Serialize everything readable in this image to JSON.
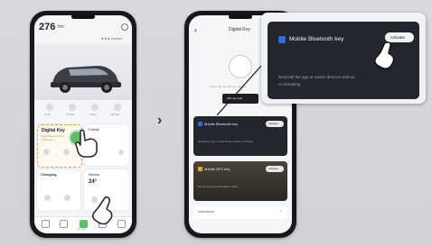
{
  "phone1": {
    "time": "276",
    "time_unit": "km",
    "status_text": "● ● ●  Locked",
    "hero_title": "—",
    "shortcuts": [
      "Lock",
      "Unlock",
      "Trunk",
      "Climate"
    ],
    "digital_key_title": "Digital Key",
    "digital_key_sub1": "Add Bluetooth key",
    "digital_key_sub2": "Share key",
    "family_label": "Family",
    "charging_label": "Charging",
    "charging_sub": "—",
    "climate_label": "Interior",
    "climate_value": "24°",
    "tab_labels": [
      "Home",
      "Map",
      "My Car",
      "Service",
      "Me"
    ]
  },
  "arrow": "›",
  "phone2": {
    "header_title": "Digital Key",
    "back_icon": "‹",
    "help_line": "Unlock the car with your phone",
    "add_button": "Add key now",
    "bt_key_label": "Mobile Bluetooth key",
    "bt_activate": "Activate",
    "bt_desc": "Reinstall the app or switch devices without re-activating",
    "nfc_key_label": "Mobile NFC key",
    "nfc_activate": "Activate",
    "nfc_desc": "Tap your phone on the B-pillar to unlock",
    "instructions_label": "Instructions",
    "instructions_chev": "›"
  },
  "popup": {
    "title": "Mobile Bluetooth key",
    "activate": "Activate",
    "desc_line1": "Reinstall the app or switch devices without",
    "desc_line2": "re-activating"
  },
  "colors": {
    "accent_green": "#5cbf62",
    "dark_card": "#23262d",
    "bt_blue": "#2d6cdf",
    "highlight_orange": "#f2a13b"
  }
}
